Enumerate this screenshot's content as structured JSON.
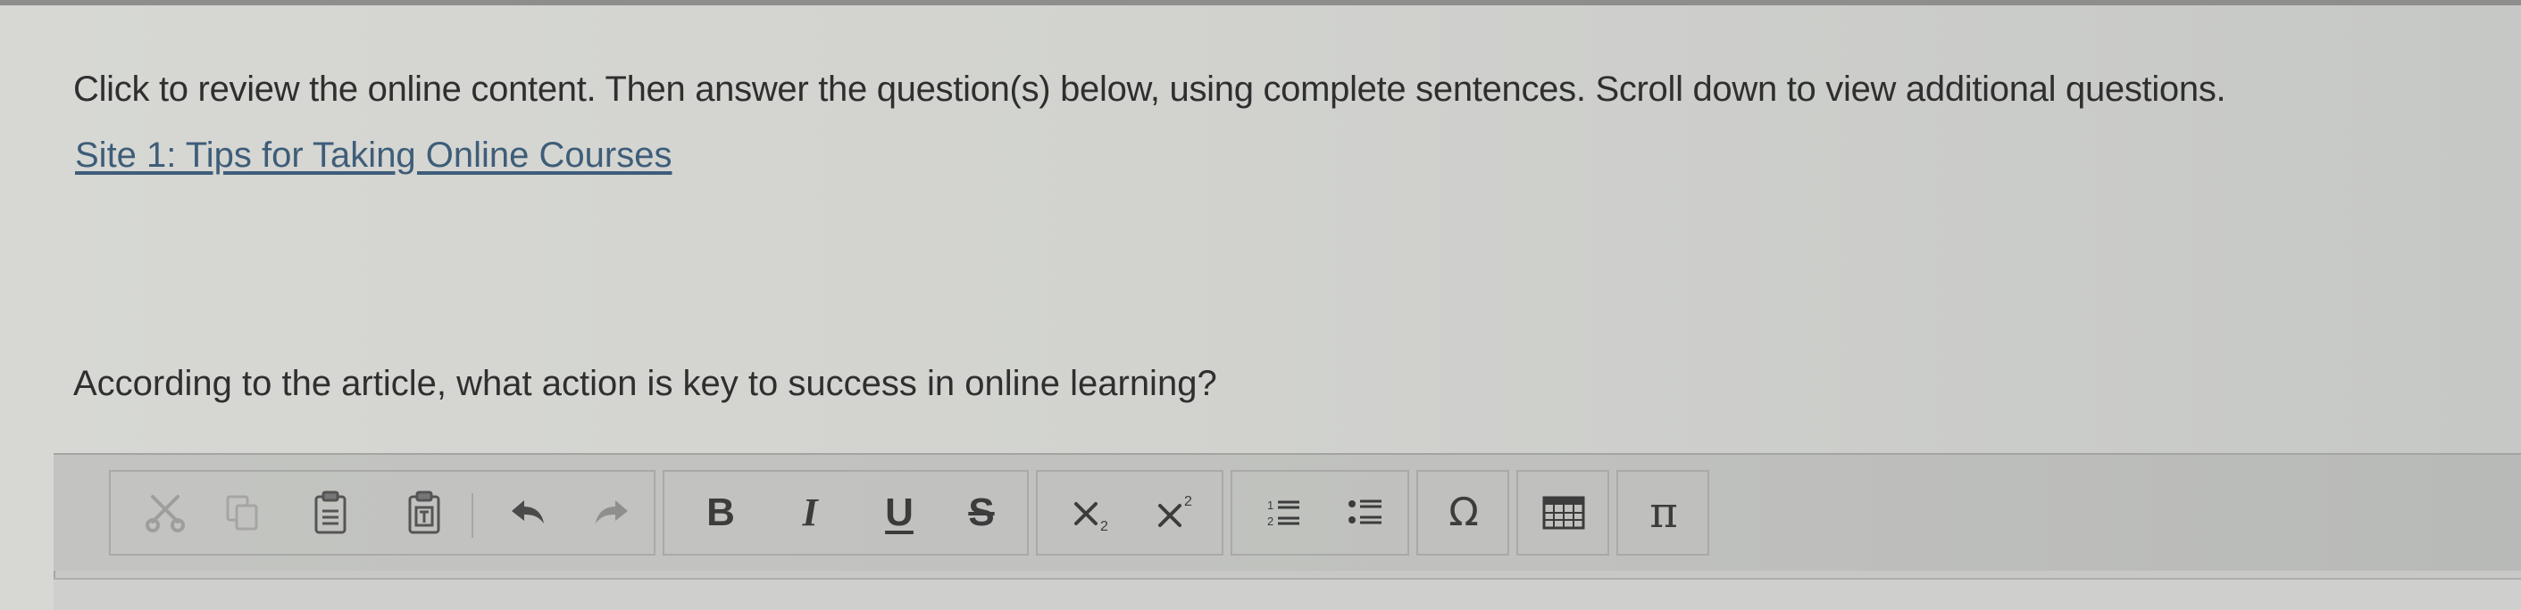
{
  "instructions": "Click to review the online content. Then answer the question(s) below, using complete sentences. Scroll down to view additional questions.",
  "site_link": "Site 1: Tips for Taking Online Courses",
  "question": "According to the article, what action is key to success in online learning?",
  "toolbar": {
    "bold_label": "B",
    "italic_label": "I",
    "underline_label": "U",
    "strike_label": "S",
    "omega_label": "Ω",
    "pi_label": "π"
  },
  "colors": {
    "link": "#3e5d79",
    "text": "#2f2f2f",
    "toolbar_bg": "#c2c3c0"
  },
  "icons": [
    "cut-icon",
    "copy-icon",
    "paste-icon",
    "paste-text-icon",
    "undo-icon",
    "redo-icon",
    "bold-icon",
    "italic-icon",
    "underline-icon",
    "strikethrough-icon",
    "subscript-icon",
    "superscript-icon",
    "numbered-list-icon",
    "bulleted-list-icon",
    "special-character-icon",
    "table-icon",
    "math-pi-icon"
  ]
}
